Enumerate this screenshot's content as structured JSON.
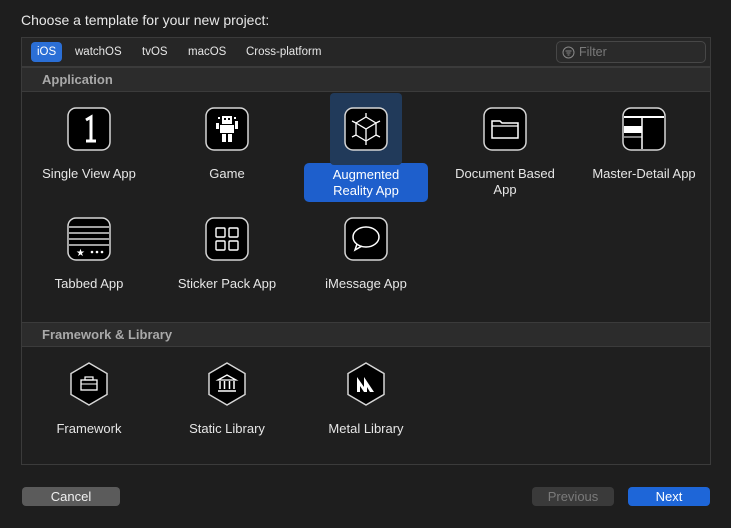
{
  "window": {
    "title": "Choose a template for your new project:"
  },
  "tabs": [
    {
      "label": "iOS",
      "active": true
    },
    {
      "label": "watchOS",
      "active": false
    },
    {
      "label": "tvOS",
      "active": false
    },
    {
      "label": "macOS",
      "active": false
    },
    {
      "label": "Cross-platform",
      "active": false
    }
  ],
  "filter": {
    "placeholder": "Filter",
    "value": ""
  },
  "sections": [
    {
      "title": "Application",
      "templates": [
        {
          "label": "Single View App",
          "icon": "single-view-icon"
        },
        {
          "label": "Game",
          "icon": "game-icon"
        },
        {
          "label": "Augmented Reality App",
          "icon": "augmented-reality-icon",
          "selected": true
        },
        {
          "label": "Document Based App",
          "icon": "document-icon"
        },
        {
          "label": "Master-Detail App",
          "icon": "master-detail-icon"
        },
        {
          "label": "Tabbed App",
          "icon": "tabbed-icon"
        },
        {
          "label": "Sticker Pack App",
          "icon": "sticker-pack-icon"
        },
        {
          "label": "iMessage App",
          "icon": "imessage-icon"
        }
      ]
    },
    {
      "title": "Framework & Library",
      "templates": [
        {
          "label": "Framework",
          "icon": "framework-icon"
        },
        {
          "label": "Static Library",
          "icon": "static-library-icon"
        },
        {
          "label": "Metal Library",
          "icon": "metal-library-icon"
        }
      ]
    }
  ],
  "buttons": {
    "cancel": "Cancel",
    "previous": "Previous",
    "next": "Next"
  },
  "colors": {
    "accent": "#1e66d8",
    "selection": "#1e5fcc",
    "background": "#1e1e1e"
  }
}
